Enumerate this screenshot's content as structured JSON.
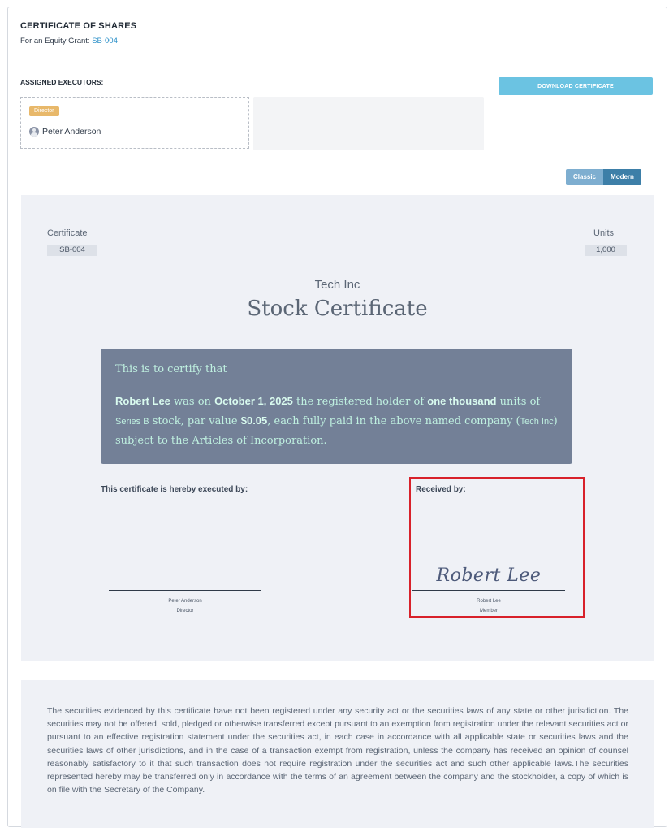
{
  "header": {
    "title": "CERTIFICATE OF SHARES",
    "subtitle_prefix": "For an Equity Grant:",
    "grant_link": "SB-004"
  },
  "executors": {
    "label": "ASSIGNED EXECUTORS:",
    "items": [
      {
        "role": "Director",
        "name": "Peter Anderson"
      }
    ]
  },
  "actions": {
    "download_label": "DOWNLOAD CERTIFICATE"
  },
  "view_toggle": {
    "options": [
      "Classic",
      "Modern"
    ],
    "selected": "Modern"
  },
  "certificate": {
    "certificate_label": "Certificate",
    "certificate_value": "SB-004",
    "units_label": "Units",
    "units_value": "1,000",
    "company": "Tech Inc",
    "title": "Stock Certificate",
    "certify_heading": "This is to certify that",
    "holder_name": "Robert Lee",
    "text_1": " was on ",
    "date": "October 1, 2025",
    "text_2": " the registered holder of ",
    "units_words": "one thousand",
    "text_3": " units of ",
    "series": "Series B",
    "text_4": " stock, par value ",
    "par_value": "$0.05",
    "text_5": ", each fully paid in the above named company (",
    "company_inline": "Tech Inc",
    "text_6": ") subject to the Articles of Incorporation."
  },
  "signatures": {
    "executed_label": "This certificate is hereby executed by:",
    "received_label": "Received by:",
    "executor_name": "Peter Anderson",
    "executor_role": "Director",
    "recipient_signature": "Robert Lee",
    "recipient_name": "Robert Lee",
    "recipient_role": "Member"
  },
  "legend": "The securities evidenced by this certificate have not been registered under any security act or the securities laws of any state or other jurisdiction. The securities may not be offered, sold, pledged or otherwise transferred except pursuant to an exemption from registration under the relevant securities act or pursuant to an effective registration statement under the securities act, in each case in accordance with all applicable state or securities laws and the securities laws of other jurisdictions, and in the case of a transaction exempt from registration, unless the company has received an opinion of counsel reasonably satisfactory to it that such transaction does not require registration under the securities act and such other applicable laws.The securities represented hereby may be transferred only in accordance with the terms of an agreement between the company and the stockholder, a copy of which is on file with the Secretary of the Company.",
  "colors": {
    "accent": "#6bc3e2",
    "toggle_active": "#3d7fa8",
    "toggle_inactive": "#7eaed0",
    "role_badge": "#e8b86a",
    "certify_box": "#738097",
    "certify_text": "#bff0e0",
    "highlight": "#d8212a"
  }
}
